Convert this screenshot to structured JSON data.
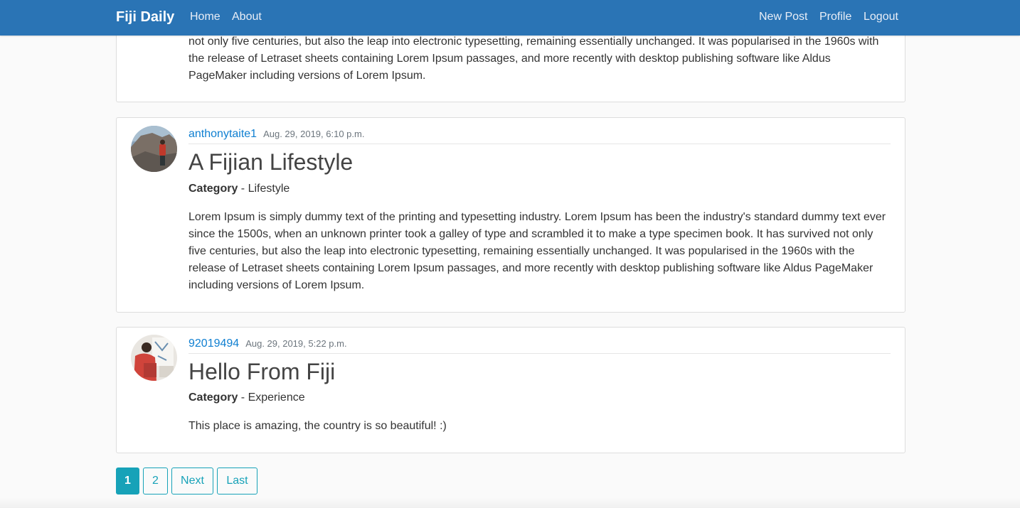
{
  "nav": {
    "brand": "Fiji Daily",
    "left_links": [
      "Home",
      "About"
    ],
    "right_links": [
      "New Post",
      "Profile",
      "Logout"
    ],
    "color": "#2a74b5"
  },
  "posts": [
    {
      "body": "not only five centuries, but also the leap into electronic typesetting, remaining essentially unchanged. It was popularised in the 1960s with the release of Letraset sheets containing Lorem Ipsum passages, and more recently with desktop publishing software like Aldus PageMaker including versions of Lorem Ipsum."
    },
    {
      "author": "anthonytaite1",
      "date": "Aug. 29, 2019, 6:10 p.m.",
      "title": "A Fijian Lifestyle",
      "category_label": "Category",
      "category_value": " - Lifestyle",
      "body": "Lorem Ipsum is simply dummy text of the printing and typesetting industry. Lorem Ipsum has been the industry's standard dummy text ever since the 1500s, when an unknown printer took a galley of type and scrambled it to make a type specimen book. It has survived not only five centuries, but also the leap into electronic typesetting, remaining essentially unchanged. It was popularised in the 1960s with the release of Letraset sheets containing Lorem Ipsum passages, and more recently with desktop publishing software like Aldus PageMaker including versions of Lorem Ipsum."
    },
    {
      "author": "92019494",
      "date": "Aug. 29, 2019, 5:22 p.m.",
      "title": "Hello From Fiji",
      "category_label": "Category",
      "category_value": " - Experience",
      "body": "This place is amazing, the country is so beautiful! :)"
    }
  ],
  "pagination": {
    "pages": [
      "1",
      "2"
    ],
    "next": "Next",
    "last": "Last",
    "active": "1",
    "color": "#17a2b8"
  }
}
